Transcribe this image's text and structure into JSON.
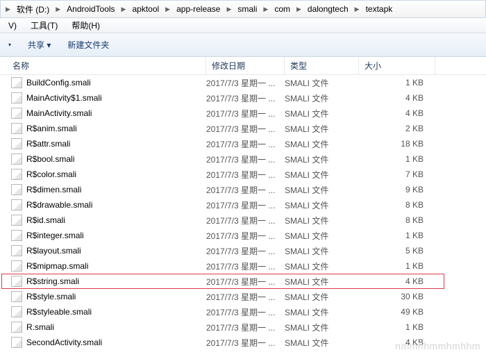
{
  "breadcrumb": [
    "软件 (D:)",
    "AndroidTools",
    "apktool",
    "app-release",
    "smali",
    "com",
    "dalongtech",
    "textapk"
  ],
  "menubar": {
    "view": "V)",
    "tools": "工具(T)",
    "help": "帮助(H)"
  },
  "toolbar": {
    "share": "共享 ▾",
    "newfolder": "新建文件夹"
  },
  "columns": {
    "name": "名称",
    "date": "修改日期",
    "type": "类型",
    "size": "大小"
  },
  "files": [
    {
      "name": "BuildConfig.smali",
      "date": "2017/7/3 星期一 ...",
      "type": "SMALI 文件",
      "size": "1 KB",
      "hl": false
    },
    {
      "name": "MainActivity$1.smali",
      "date": "2017/7/3 星期一 ...",
      "type": "SMALI 文件",
      "size": "4 KB",
      "hl": false
    },
    {
      "name": "MainActivity.smali",
      "date": "2017/7/3 星期一 ...",
      "type": "SMALI 文件",
      "size": "4 KB",
      "hl": false
    },
    {
      "name": "R$anim.smali",
      "date": "2017/7/3 星期一 ...",
      "type": "SMALI 文件",
      "size": "2 KB",
      "hl": false
    },
    {
      "name": "R$attr.smali",
      "date": "2017/7/3 星期一 ...",
      "type": "SMALI 文件",
      "size": "18 KB",
      "hl": false
    },
    {
      "name": "R$bool.smali",
      "date": "2017/7/3 星期一 ...",
      "type": "SMALI 文件",
      "size": "1 KB",
      "hl": false
    },
    {
      "name": "R$color.smali",
      "date": "2017/7/3 星期一 ...",
      "type": "SMALI 文件",
      "size": "7 KB",
      "hl": false
    },
    {
      "name": "R$dimen.smali",
      "date": "2017/7/3 星期一 ...",
      "type": "SMALI 文件",
      "size": "9 KB",
      "hl": false
    },
    {
      "name": "R$drawable.smali",
      "date": "2017/7/3 星期一 ...",
      "type": "SMALI 文件",
      "size": "8 KB",
      "hl": false
    },
    {
      "name": "R$id.smali",
      "date": "2017/7/3 星期一 ...",
      "type": "SMALI 文件",
      "size": "8 KB",
      "hl": false
    },
    {
      "name": "R$integer.smali",
      "date": "2017/7/3 星期一 ...",
      "type": "SMALI 文件",
      "size": "1 KB",
      "hl": false
    },
    {
      "name": "R$layout.smali",
      "date": "2017/7/3 星期一 ...",
      "type": "SMALI 文件",
      "size": "5 KB",
      "hl": false
    },
    {
      "name": "R$mipmap.smali",
      "date": "2017/7/3 星期一 ...",
      "type": "SMALI 文件",
      "size": "1 KB",
      "hl": false
    },
    {
      "name": "R$string.smali",
      "date": "2017/7/3 星期一 ...",
      "type": "SMALI 文件",
      "size": "4 KB",
      "hl": true
    },
    {
      "name": "R$style.smali",
      "date": "2017/7/3 星期一 ...",
      "type": "SMALI 文件",
      "size": "30 KB",
      "hl": false
    },
    {
      "name": "R$styleable.smali",
      "date": "2017/7/3 星期一 ...",
      "type": "SMALI 文件",
      "size": "49 KB",
      "hl": false
    },
    {
      "name": "R.smali",
      "date": "2017/7/3 星期一 ...",
      "type": "SMALI 文件",
      "size": "1 KB",
      "hl": false
    },
    {
      "name": "SecondActivity.smali",
      "date": "2017/7/3 星期一 ...",
      "type": "SMALI 文件",
      "size": "4 KB",
      "hl": false
    }
  ],
  "watermark": "nmmhhmmhmhhm"
}
